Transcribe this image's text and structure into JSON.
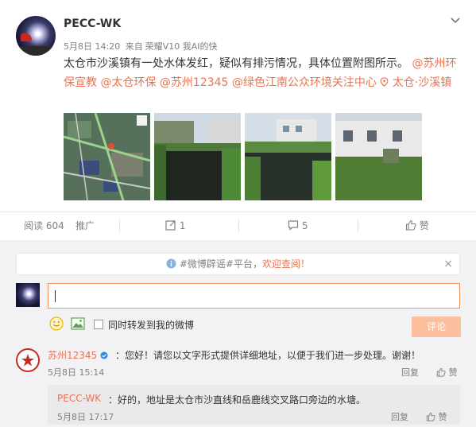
{
  "post": {
    "username": "PECC-WK",
    "date": "5月8日 14:20",
    "source_prefix": "来自",
    "source_device": "荣耀V10 我AI的快",
    "text_main": "太仓市沙溪镇有一处水体发红，疑似有排污情况，具体位置附图所示。",
    "mentions": [
      "@苏州环保宣教",
      "@太仓环保",
      "@苏州12345",
      "@绿色江南公众环境关注中心"
    ],
    "location": "太仓·沙溪镇"
  },
  "actions": {
    "read_label": "阅读 604",
    "promote_label": "推广",
    "repost_count": "1",
    "comment_count": "5",
    "like_label": "赞"
  },
  "comments": {
    "notice_prefix": "#微博辟谣#平台，",
    "notice_highlight": "欢迎查阅！",
    "repost_checkbox_label": "同时转发到我的微博",
    "submit_label": "评论",
    "items": [
      {
        "user": "苏州12345",
        "text": "：您好！请您以文字形式提供详细地址，以便于我们进一步处理。谢谢！",
        "time": "5月8日 15:14",
        "reply_label": "回复",
        "like_label": "赞"
      }
    ],
    "sub_reply": {
      "user": "PECC-WK",
      "text": "：好的，地址是太仓市沙直线和岳鹿线交叉路口旁边的水塘。",
      "time": "5月8日 17:17",
      "reply_label": "回复",
      "like_label": "赞"
    }
  },
  "colors": {
    "link": "#eb7350",
    "submit_bg": "#fbbf9e",
    "input_border": "#f28e5c"
  },
  "icons": [
    "chevron-down-icon",
    "location-pin-icon",
    "repost-icon",
    "comment-icon",
    "like-icon",
    "info-icon",
    "close-icon",
    "emoji-icon",
    "image-icon"
  ]
}
